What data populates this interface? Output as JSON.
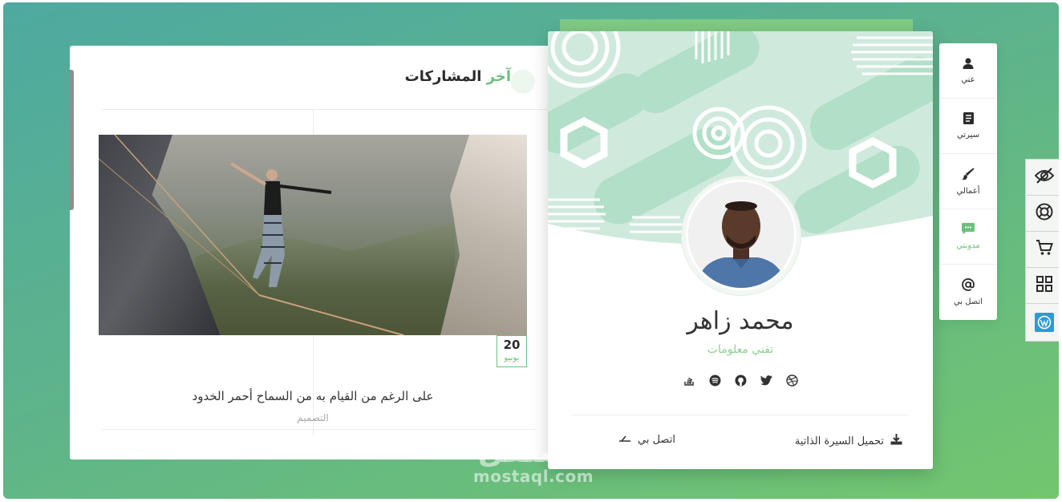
{
  "blog": {
    "title_accent": "آخر",
    "title_rest": "المشاركات",
    "post": {
      "date_day": "20",
      "date_month": "يونيو",
      "title": "على الرغم من القيام به من السماح أحمر الخدود",
      "category": "التصميم"
    }
  },
  "profile": {
    "name": "محمد زاهر",
    "role": "تقني معلومات",
    "social_icons": [
      "dribbble-icon",
      "twitter-icon",
      "github-icon",
      "spotify-icon",
      "stack-overflow-icon"
    ],
    "download_cv_label": "تحميل السيرة الذاتية",
    "contact_label": "اتصل بي"
  },
  "nav": {
    "items": [
      {
        "label": "عني",
        "icon": "user-icon"
      },
      {
        "label": "سيرتي",
        "icon": "resume-icon"
      },
      {
        "label": "أعمالي",
        "icon": "brush-icon"
      },
      {
        "label": "مدونتي",
        "icon": "chat-icon",
        "active": true
      },
      {
        "label": "اتصل بي",
        "icon": "at-icon"
      }
    ]
  },
  "tools": [
    "eye-off-icon",
    "lifebuoy-icon",
    "cart-icon",
    "grid-icon",
    "wordpress-icon"
  ],
  "watermark": {
    "arabic": "مستقل",
    "latin": "mostaql.com"
  },
  "colors": {
    "accent": "#6cc07a",
    "background_start": "#4ea9a0",
    "background_end": "#73c66e",
    "cover_green": "#b6e2cc"
  }
}
